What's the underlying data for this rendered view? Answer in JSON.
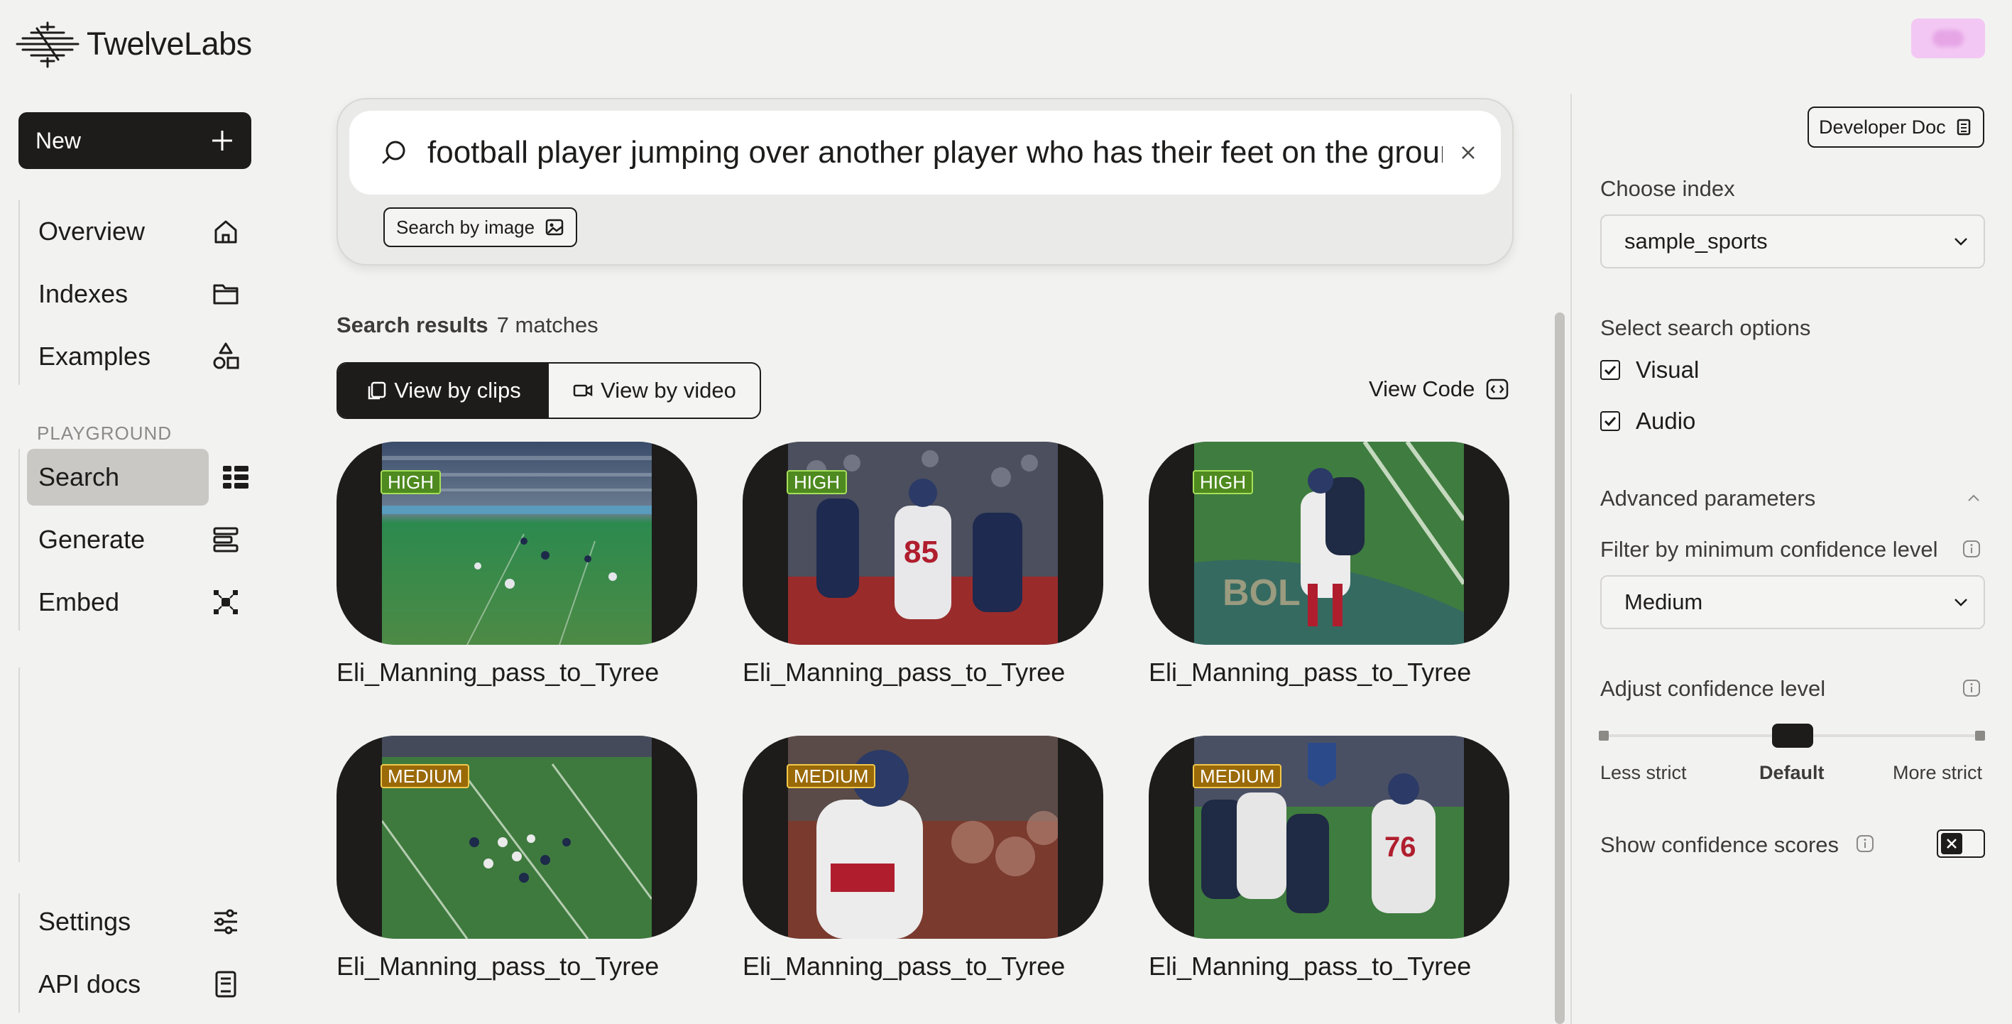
{
  "app": {
    "brand_name": "TwelveLabs"
  },
  "sidebar": {
    "new_button": "New",
    "main_nav": [
      {
        "label": "Overview",
        "icon": "home-icon"
      },
      {
        "label": "Indexes",
        "icon": "folder-icon"
      },
      {
        "label": "Examples",
        "icon": "shapes-icon"
      }
    ],
    "playground_label": "PLAYGROUND",
    "playground_nav": [
      {
        "label": "Search",
        "icon": "search-grid-icon",
        "active": true
      },
      {
        "label": "Generate",
        "icon": "generate-lines-icon"
      },
      {
        "label": "Embed",
        "icon": "embed-icon"
      }
    ],
    "bottom_nav": [
      {
        "label": "Settings",
        "icon": "sliders-icon"
      },
      {
        "label": "API docs",
        "icon": "book-icon"
      }
    ]
  },
  "search": {
    "query": "football player jumping over another player who has their feet on the ground",
    "search_by_image": "Search by image"
  },
  "results": {
    "label": "Search results",
    "count": "7 matches",
    "view_by_clips": "View by clips",
    "view_by_video": "View by video",
    "view_code": "View Code",
    "items": [
      {
        "title": "Eli_Manning_pass_to_Tyree",
        "confidence": "HIGH"
      },
      {
        "title": "Eli_Manning_pass_to_Tyree",
        "confidence": "HIGH"
      },
      {
        "title": "Eli_Manning_pass_to_Tyree",
        "confidence": "HIGH"
      },
      {
        "title": "Eli_Manning_pass_to_Tyree",
        "confidence": "MEDIUM"
      },
      {
        "title": "Eli_Manning_pass_to_Tyree",
        "confidence": "MEDIUM"
      },
      {
        "title": "Eli_Manning_pass_to_Tyree",
        "confidence": "MEDIUM"
      }
    ]
  },
  "right_panel": {
    "developer_doc": "Developer Doc",
    "choose_index_label": "Choose index",
    "index_value": "sample_sports",
    "search_options_label": "Select search options",
    "options": [
      {
        "label": "Visual",
        "checked": true
      },
      {
        "label": "Audio",
        "checked": true
      }
    ],
    "advanced_label": "Advanced parameters",
    "filter_label": "Filter by minimum confidence level",
    "filter_value": "Medium",
    "adjust_label": "Adjust confidence level",
    "slider": {
      "less": "Less strict",
      "default": "Default",
      "more": "More strict",
      "value": "Default"
    },
    "show_scores_label": "Show confidence scores",
    "show_scores_on": false
  },
  "colors": {
    "background": "#f2f2f1",
    "primary_dark": "#1d1c1b",
    "badge_high": "#4e8a1f",
    "badge_medium": "#9a6a08"
  }
}
